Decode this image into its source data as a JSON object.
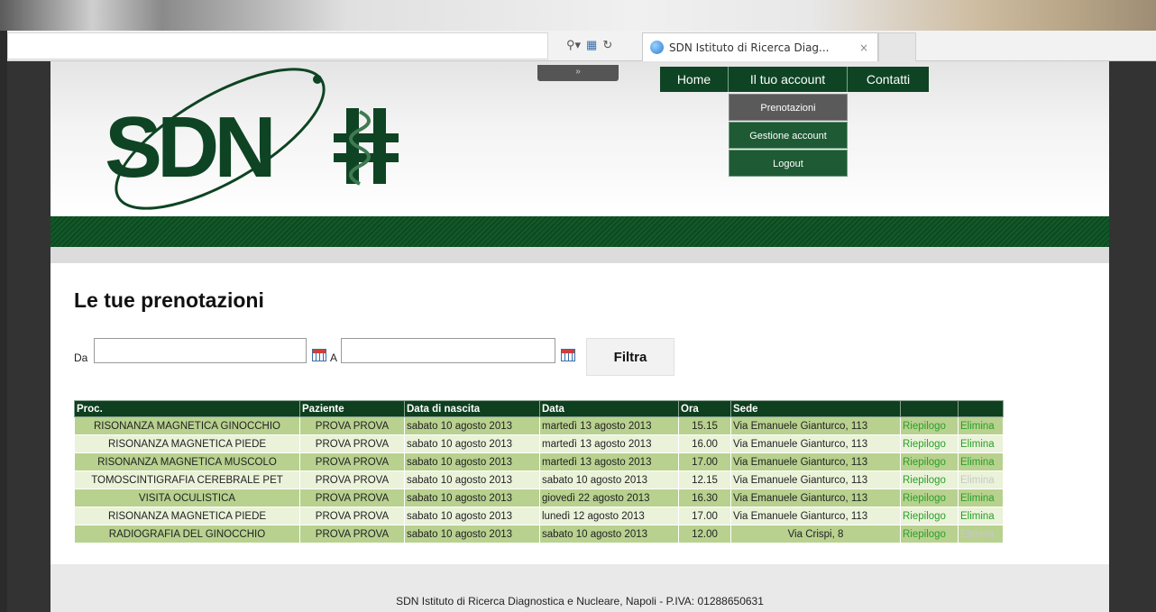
{
  "browser": {
    "tab_title": "SDN Istituto di Ricerca Diag...",
    "tab_close": "×",
    "search_icon": "search-icon",
    "compat_icon": "compat-view-icon",
    "refresh_icon": "refresh-icon"
  },
  "header": {
    "grip": "»",
    "nav": [
      {
        "label": "Home"
      },
      {
        "label": "Il tuo account"
      },
      {
        "label": "Contatti"
      }
    ],
    "dropdown": [
      {
        "label": "Prenotazioni"
      },
      {
        "label": "Gestione account"
      },
      {
        "label": "Logout"
      }
    ]
  },
  "main": {
    "title": "Le tue prenotazioni",
    "filter": {
      "from_label": "Da",
      "to_label": "A",
      "from_value": "",
      "to_value": "",
      "button": "Filtra"
    },
    "table": {
      "columns": [
        "Proc.",
        "Paziente",
        "Data di nascita",
        "Data",
        "Ora",
        "Sede",
        "",
        ""
      ],
      "rows": [
        {
          "proc": "RISONANZA MAGNETICA GINOCCHIO",
          "paziente": "PROVA PROVA",
          "nascita": "sabato 10 agosto 2013",
          "data": "martedì 13 agosto 2013",
          "ora": "15.15",
          "sede": "Via Emanuele Gianturco, 113",
          "riepilogo": "Riepilogo",
          "elimina": "Elimina",
          "elimina_enabled": true
        },
        {
          "proc": "RISONANZA MAGNETICA PIEDE",
          "paziente": "PROVA PROVA",
          "nascita": "sabato 10 agosto 2013",
          "data": "martedì 13 agosto 2013",
          "ora": "16.00",
          "sede": "Via Emanuele Gianturco, 113",
          "riepilogo": "Riepilogo",
          "elimina": "Elimina",
          "elimina_enabled": true
        },
        {
          "proc": "RISONANZA MAGNETICA MUSCOLO",
          "paziente": "PROVA PROVA",
          "nascita": "sabato 10 agosto 2013",
          "data": "martedì 13 agosto 2013",
          "ora": "17.00",
          "sede": "Via Emanuele Gianturco, 113",
          "riepilogo": "Riepilogo",
          "elimina": "Elimina",
          "elimina_enabled": true
        },
        {
          "proc": "TOMOSCINTIGRAFIA CEREBRALE PET",
          "paziente": "PROVA PROVA",
          "nascita": "sabato 10 agosto 2013",
          "data": "sabato 10 agosto 2013",
          "ora": "12.15",
          "sede": "Via Emanuele Gianturco, 113",
          "riepilogo": "Riepilogo",
          "elimina": "Elimina",
          "elimina_enabled": false
        },
        {
          "proc": "VISITA OCULISTICA",
          "paziente": "PROVA PROVA",
          "nascita": "sabato 10 agosto 2013",
          "data": "giovedì 22 agosto 2013",
          "ora": "16.30",
          "sede": "Via Emanuele Gianturco, 113",
          "riepilogo": "Riepilogo",
          "elimina": "Elimina",
          "elimina_enabled": true
        },
        {
          "proc": "RISONANZA MAGNETICA PIEDE",
          "paziente": "PROVA PROVA",
          "nascita": "sabato 10 agosto 2013",
          "data": "lunedì 12 agosto 2013",
          "ora": "17.00",
          "sede": "Via Emanuele Gianturco, 113",
          "riepilogo": "Riepilogo",
          "elimina": "Elimina",
          "elimina_enabled": true
        },
        {
          "proc": "RADIOGRAFIA DEL GINOCCHIO",
          "paziente": "PROVA PROVA",
          "nascita": "sabato 10 agosto 2013",
          "data": "sabato 10 agosto 2013",
          "ora": "12.00",
          "sede": "Via Crispi, 8",
          "riepilogo": "Riepilogo",
          "elimina": "Elimina",
          "elimina_enabled": false
        }
      ]
    }
  },
  "footer": {
    "text": "SDN Istituto di Ricerca Diagnostica e Nucleare, Napoli - P.IVA: 01288650631"
  },
  "colors": {
    "brand_green": "#0e4423",
    "row_odd": "#b8d18f",
    "row_even": "#eaf2d9",
    "link_green": "#2aa02a"
  }
}
